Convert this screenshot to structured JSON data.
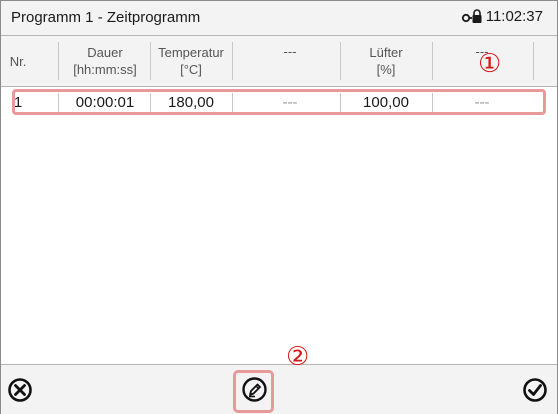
{
  "title": "Programm 1 - Zeitprogramm",
  "clock": "11:02:37",
  "columns": [
    {
      "line1": "Nr.",
      "line2": ""
    },
    {
      "line1": "Dauer",
      "line2": "[hh:mm:ss]"
    },
    {
      "line1": "Temperatur",
      "line2": "[°C]"
    },
    {
      "line1": "---",
      "line2": ""
    },
    {
      "line1": "Lüfter",
      "line2": "[%]"
    },
    {
      "line1": "---",
      "line2": ""
    }
  ],
  "rows": [
    {
      "nr": "1",
      "dauer": "00:00:01",
      "temperatur": "180,00",
      "extra1": "---",
      "luefter": "100,00",
      "extra2": "---"
    }
  ],
  "callouts": [
    "①",
    "②"
  ],
  "icons": {
    "cancel": "cancel-icon",
    "edit": "edit-icon",
    "confirm": "confirm-icon",
    "lock": "lock-icon"
  }
}
